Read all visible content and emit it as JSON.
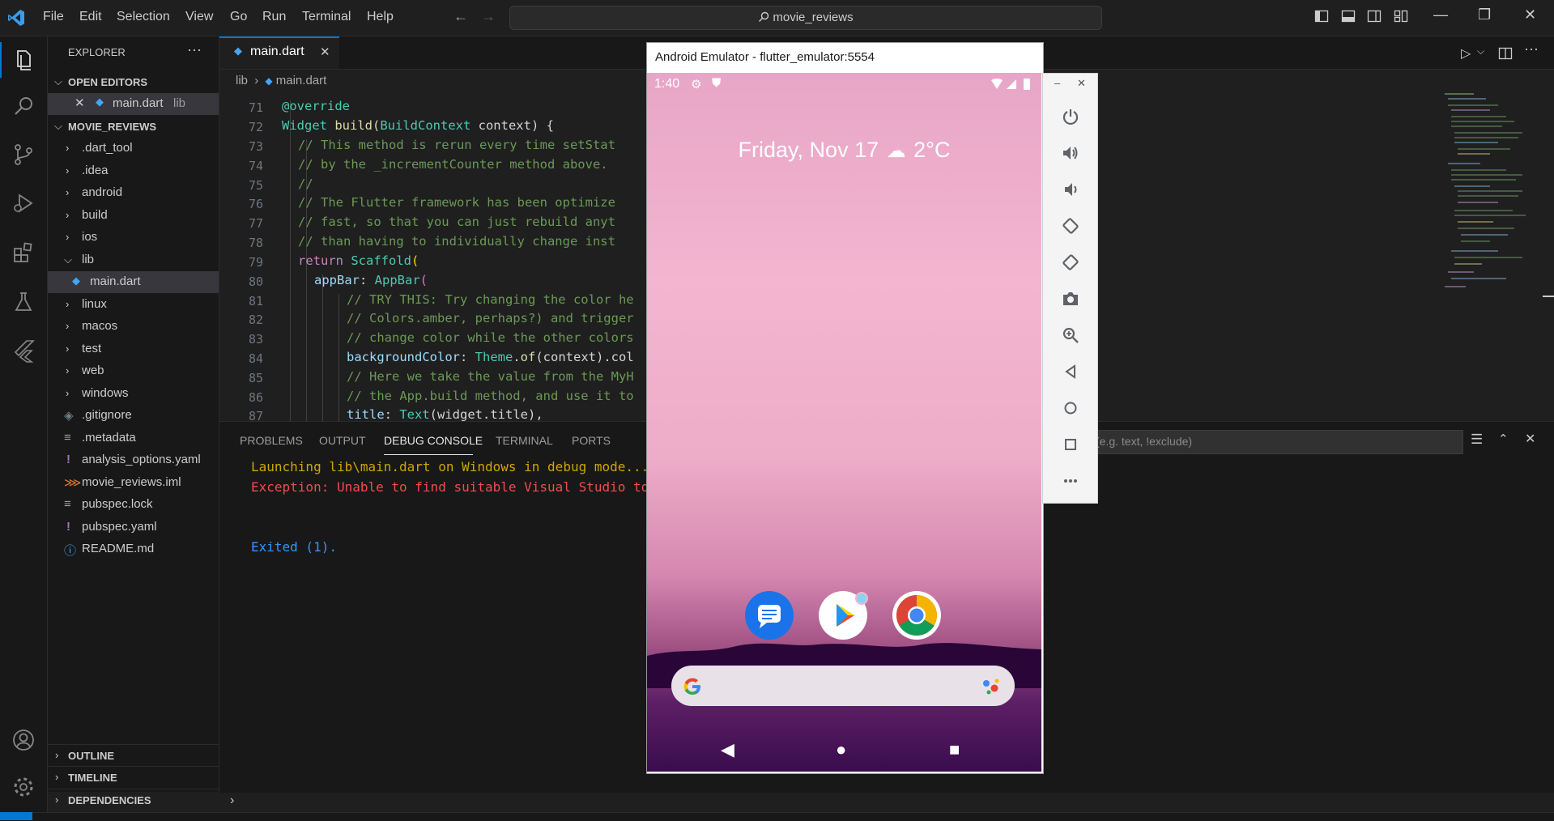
{
  "titlebar": {
    "menu": [
      "File",
      "Edit",
      "Selection",
      "View",
      "Go",
      "Run",
      "Terminal",
      "Help"
    ],
    "search_text": "movie_reviews"
  },
  "sidebar": {
    "header": "EXPLORER",
    "open_editors_label": "OPEN EDITORS",
    "open_editor_file": "main.dart",
    "open_editor_dir": "lib",
    "project_label": "MOVIE_REVIEWS",
    "folders": [
      ".dart_tool",
      ".idea",
      "android",
      "build",
      "ios",
      "lib"
    ],
    "lib_child": "main.dart",
    "folders2": [
      "linux",
      "macos",
      "test",
      "web",
      "windows"
    ],
    "files": [
      ".gitignore",
      ".metadata",
      "analysis_options.yaml",
      "movie_reviews.iml",
      "pubspec.lock",
      "pubspec.yaml",
      "README.md"
    ],
    "outline_label": "OUTLINE",
    "timeline_label": "TIMELINE",
    "dependencies_label": "DEPENDENCIES"
  },
  "editor": {
    "tab_label": "main.dart",
    "breadcrumb_dir": "lib",
    "breadcrumb_file": "main.dart",
    "line_numbers": [
      "71",
      "72",
      "73",
      "74",
      "75",
      "76",
      "77",
      "78",
      "79",
      "80",
      "81",
      "82",
      "83",
      "84",
      "85",
      "86",
      "87"
    ]
  },
  "code": {
    "l71": "@override",
    "l72_a": "Widget",
    "l72_b": " build(",
    "l72_c": "BuildContext",
    "l72_d": " context) {",
    "l73": "// This method is rerun every time setStat",
    "l74": "// by the _incrementCounter method above.",
    "l75": "//",
    "l76": "// The Flutter framework has been optimize",
    "l77": "// fast, so that you can just rebuild anyt",
    "l78": "// than having to individually change inst",
    "l79_a": "return",
    "l79_b": "Scaffold",
    "l79_c": "(",
    "l80_a": "appBar",
    "l80_b": ": ",
    "l80_c": "AppBar",
    "l80_d": "(",
    "l81": "// TRY THIS: Try changing the color he",
    "l82": "// Colors.amber, perhaps?) and trigger",
    "l83": "// change color while the other colors",
    "l84_a": "backgroundColor",
    "l84_b": ": ",
    "l84_c": "Theme",
    "l84_d": ".",
    "l84_e": "of",
    "l84_f": "(context).col",
    "l85": "// Here we take the value from the MyH",
    "l86": "// the App.build method, and use it to",
    "l87_a": "title",
    "l87_b": ": ",
    "l87_c": "Text",
    "l87_d": "(widget.title),"
  },
  "panel": {
    "tabs": [
      "PROBLEMS",
      "OUTPUT",
      "DEBUG CONSOLE",
      "TERMINAL",
      "PORTS"
    ],
    "filter_placeholder": "(e.g. text, !exclude)",
    "line1": "Launching lib\\main.dart on Windows in debug mode...",
    "line2": "Exception: Unable to find suitable Visual Studio to",
    "line3": "Exited (1)."
  },
  "emulator": {
    "window_title": "Android Emulator - flutter_emulator:5554",
    "time": "1:40",
    "date_text": "Friday, Nov 17",
    "temp": "2°C"
  },
  "colors": {
    "accent": "#0078d4",
    "error": "#f14c4c",
    "warning": "#cca700",
    "info": "#3794ff"
  }
}
